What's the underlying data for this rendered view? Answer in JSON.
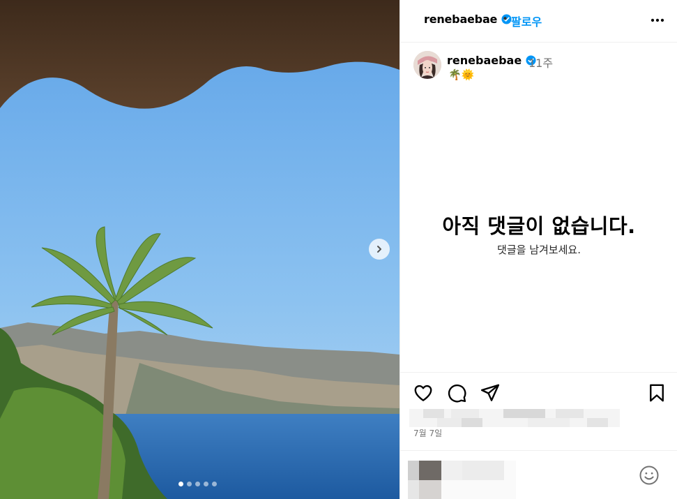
{
  "header": {
    "username": "renebaebae",
    "separator": "•",
    "follow_label": "팔로우",
    "verified_icon": "verified-badge-icon",
    "more_icon": "more-options-icon"
  },
  "caption": {
    "username": "renebaebae",
    "time_ago": "11주",
    "text": "🌴🌞"
  },
  "comments": {
    "empty_title": "아직 댓글이 없습니다.",
    "empty_subtitle": "댓글을 남겨보세요."
  },
  "media": {
    "carousel_count": 5,
    "carousel_active_index": 0,
    "next_icon": "chevron-right-icon"
  },
  "actions": {
    "icons": [
      "heart-icon",
      "comment-icon",
      "share-icon",
      "bookmark-icon"
    ]
  },
  "post": {
    "date": "7월 7일"
  },
  "colors": {
    "accent": "#0095f6",
    "verified": "#0095f6",
    "muted": "#737373",
    "border": "#efefef"
  }
}
